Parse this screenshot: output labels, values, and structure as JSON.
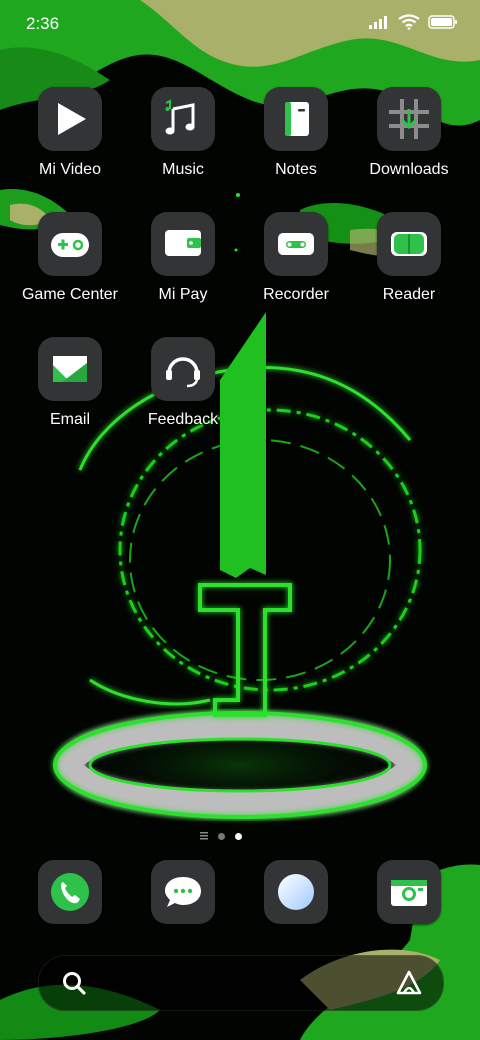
{
  "status_bar": {
    "time": "2:36",
    "icons": [
      "signal-icon",
      "wifi-icon",
      "battery-icon"
    ]
  },
  "apps": [
    {
      "label": "Mi Video",
      "icon": "play-icon"
    },
    {
      "label": "Music",
      "icon": "music-note-icon"
    },
    {
      "label": "Notes",
      "icon": "notes-icon"
    },
    {
      "label": "Downloads",
      "icon": "download-icon"
    },
    {
      "label": "Game Center",
      "icon": "gamepad-icon"
    },
    {
      "label": "Mi Pay",
      "icon": "wallet-icon"
    },
    {
      "label": "Recorder",
      "icon": "recorder-icon"
    },
    {
      "label": "Reader",
      "icon": "book-icon"
    },
    {
      "label": "Email",
      "icon": "envelope-icon"
    },
    {
      "label": "Feedback",
      "icon": "headset-icon"
    }
  ],
  "page_indicator": {
    "pages": 2,
    "current": 2
  },
  "dock": [
    {
      "icon": "phone-icon"
    },
    {
      "icon": "chat-icon"
    },
    {
      "icon": "browser-icon"
    },
    {
      "icon": "camera-icon"
    }
  ],
  "search_bar": {
    "icon": "search-icon",
    "assistant_icon": "assistant-icon"
  },
  "colors": {
    "accent": "#2ec24a",
    "icon_bg": "#333436",
    "wallpaper_green": "#22b322",
    "wallpaper_khaki": "#a9b36a"
  }
}
